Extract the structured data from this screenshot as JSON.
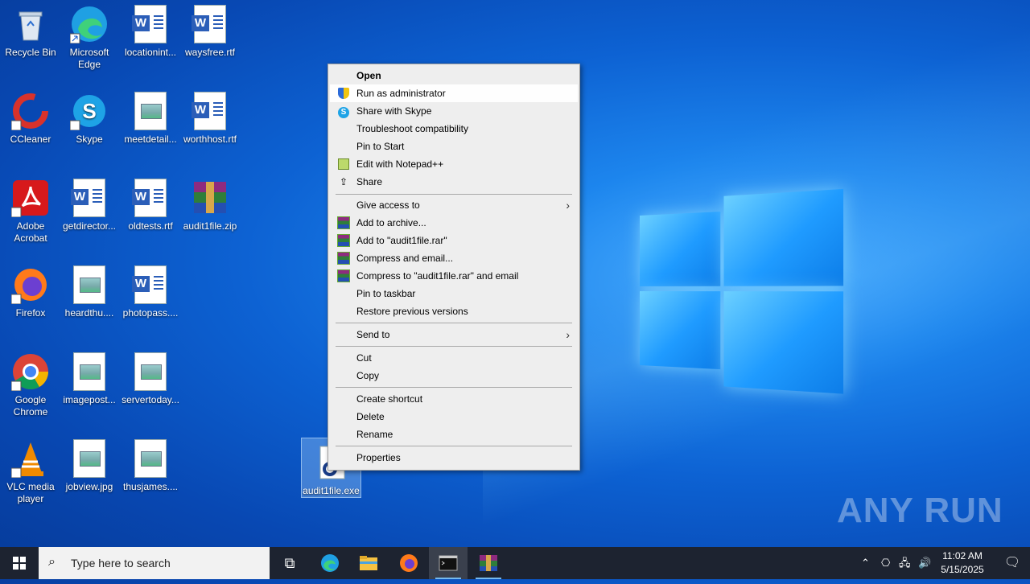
{
  "desktop": {
    "icons": [
      {
        "label": "Recycle Bin",
        "icon": "recycle-bin-icon"
      },
      {
        "label": "Microsoft Edge",
        "icon": "edge-icon"
      },
      {
        "label": "locationint...",
        "icon": "word-doc-icon"
      },
      {
        "label": "waysfree.rtf",
        "icon": "word-doc-icon"
      },
      {
        "label": "CCleaner",
        "icon": "ccleaner-icon"
      },
      {
        "label": "Skype",
        "icon": "skype-icon"
      },
      {
        "label": "meetdetail...",
        "icon": "image-file-icon"
      },
      {
        "label": "worthhost.rtf",
        "icon": "word-doc-icon"
      },
      {
        "label": "Adobe Acrobat",
        "icon": "acrobat-icon"
      },
      {
        "label": "getdirector...",
        "icon": "word-doc-icon"
      },
      {
        "label": "oldtests.rtf",
        "icon": "word-doc-icon"
      },
      {
        "label": "audit1file.zip",
        "icon": "winrar-archive-icon"
      },
      {
        "label": "Firefox",
        "icon": "firefox-icon"
      },
      {
        "label": "heardthu....",
        "icon": "image-file-icon"
      },
      {
        "label": "photopass....",
        "icon": "word-doc-icon"
      },
      {
        "label": "Google Chrome",
        "icon": "chrome-icon"
      },
      {
        "label": "imagepost...",
        "icon": "image-file-icon"
      },
      {
        "label": "servertoday...",
        "icon": "image-file-icon"
      },
      {
        "label": "VLC media player",
        "icon": "vlc-icon"
      },
      {
        "label": "jobview.jpg",
        "icon": "image-file-icon"
      },
      {
        "label": "thusjames....",
        "icon": "image-file-icon"
      },
      {
        "label": "audit1file.exe",
        "icon": "executable-icon"
      }
    ]
  },
  "context_menu": {
    "items": [
      {
        "label": "Open"
      },
      {
        "label": "Run as administrator",
        "icon": "uac-shield-icon"
      },
      {
        "label": "Share with Skype",
        "icon": "skype-icon"
      },
      {
        "label": "Troubleshoot compatibility"
      },
      {
        "label": "Pin to Start"
      },
      {
        "label": "Edit with Notepad++",
        "icon": "notepadpp-icon"
      },
      {
        "label": "Share",
        "icon": "share-icon"
      },
      {
        "label": "Give access to",
        "submenu": true
      },
      {
        "label": "Add to archive...",
        "icon": "winrar-icon"
      },
      {
        "label": "Add to \"audit1file.rar\"",
        "icon": "winrar-icon"
      },
      {
        "label": "Compress and email...",
        "icon": "winrar-icon"
      },
      {
        "label": "Compress to \"audit1file.rar\" and email",
        "icon": "winrar-icon"
      },
      {
        "label": "Pin to taskbar"
      },
      {
        "label": "Restore previous versions"
      },
      {
        "label": "Send to",
        "submenu": true
      },
      {
        "label": "Cut"
      },
      {
        "label": "Copy"
      },
      {
        "label": "Create shortcut"
      },
      {
        "label": "Delete"
      },
      {
        "label": "Rename"
      },
      {
        "label": "Properties"
      }
    ]
  },
  "taskbar": {
    "search_placeholder": "Type here to search",
    "apps": [
      "task-view-icon",
      "edge-icon",
      "file-explorer-icon",
      "firefox-icon",
      "cmd-icon",
      "winrar-icon"
    ],
    "clock_time": "11:02 AM",
    "clock_date": "5/15/2025"
  },
  "watermark": "ANY RUN"
}
